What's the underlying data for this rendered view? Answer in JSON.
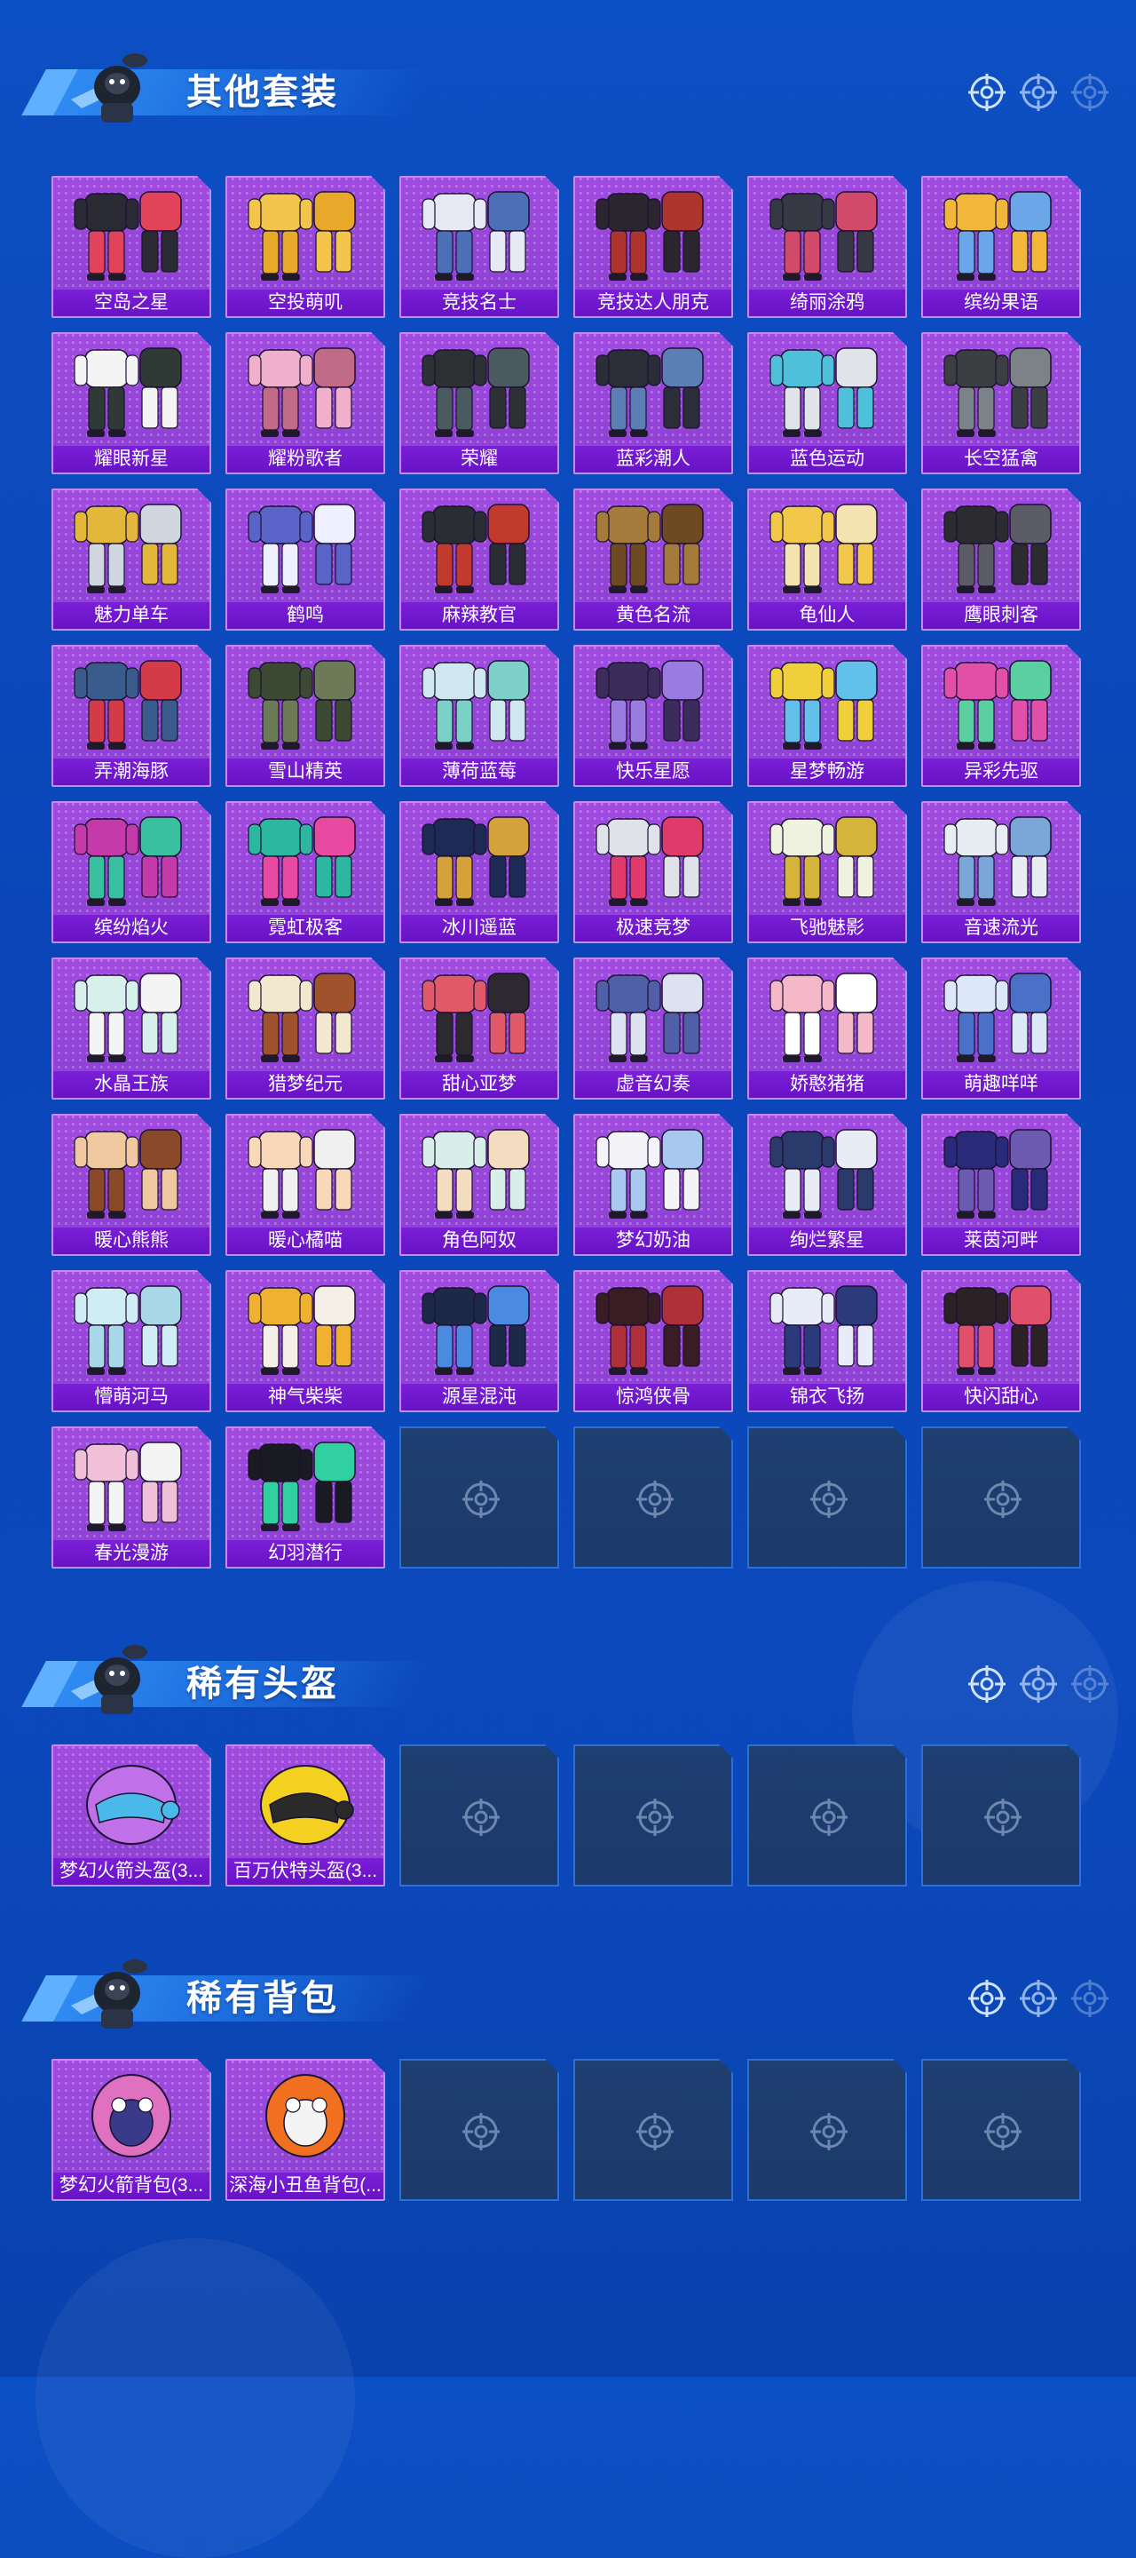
{
  "sections": [
    {
      "title": "其他套装",
      "items": [
        "空岛之星",
        "空投萌叽",
        "竞技名士",
        "竞技达人朋克",
        "绮丽涂鸦",
        "缤纷果语",
        "耀眼新星",
        "耀粉歌者",
        "荣耀",
        "蓝彩潮人",
        "蓝色运动",
        "长空猛禽",
        "魅力单车",
        "鹤鸣",
        "麻辣教官",
        "黄色名流",
        "龟仙人",
        "鹰眼刺客",
        "弄潮海豚",
        "雪山精英",
        "薄荷蓝莓",
        "快乐星愿",
        "星梦畅游",
        "异彩先驱",
        "缤纷焰火",
        "霓虹极客",
        "冰川遥蓝",
        "极速竞梦",
        "飞驰魅影",
        "音速流光",
        "水晶王族",
        "猎梦纪元",
        "甜心亚梦",
        "虚音幻奏",
        "娇憨猪猪",
        "萌趣咩咩",
        "暖心熊熊",
        "暖心橘喵",
        "角色阿奴",
        "梦幻奶油",
        "绚烂繁星",
        "莱茵河畔",
        "懵萌河马",
        "神气柴柴",
        "源星混沌",
        "惊鸿侠骨",
        "锦衣飞扬",
        "快闪甜心",
        "春光漫游",
        "幻羽潜行"
      ],
      "empty_slots": 4
    },
    {
      "title": "稀有头盔",
      "items": [
        "梦幻火箭头盔(3...",
        "百万伏特头盔(3..."
      ],
      "empty_slots": 4
    },
    {
      "title": "稀有背包",
      "items": [
        "梦幻火箭背包(3...",
        "深海小丑鱼背包(..."
      ],
      "empty_slots": 4
    }
  ],
  "colors": {
    "background": "#0b49bd",
    "tile_fill": "#9645da",
    "tile_label": "#6d16cb",
    "empty_tile": "#1e3f72"
  },
  "icons": {
    "section_mascot": "mascot-icon",
    "target": "crosshair-icon"
  }
}
